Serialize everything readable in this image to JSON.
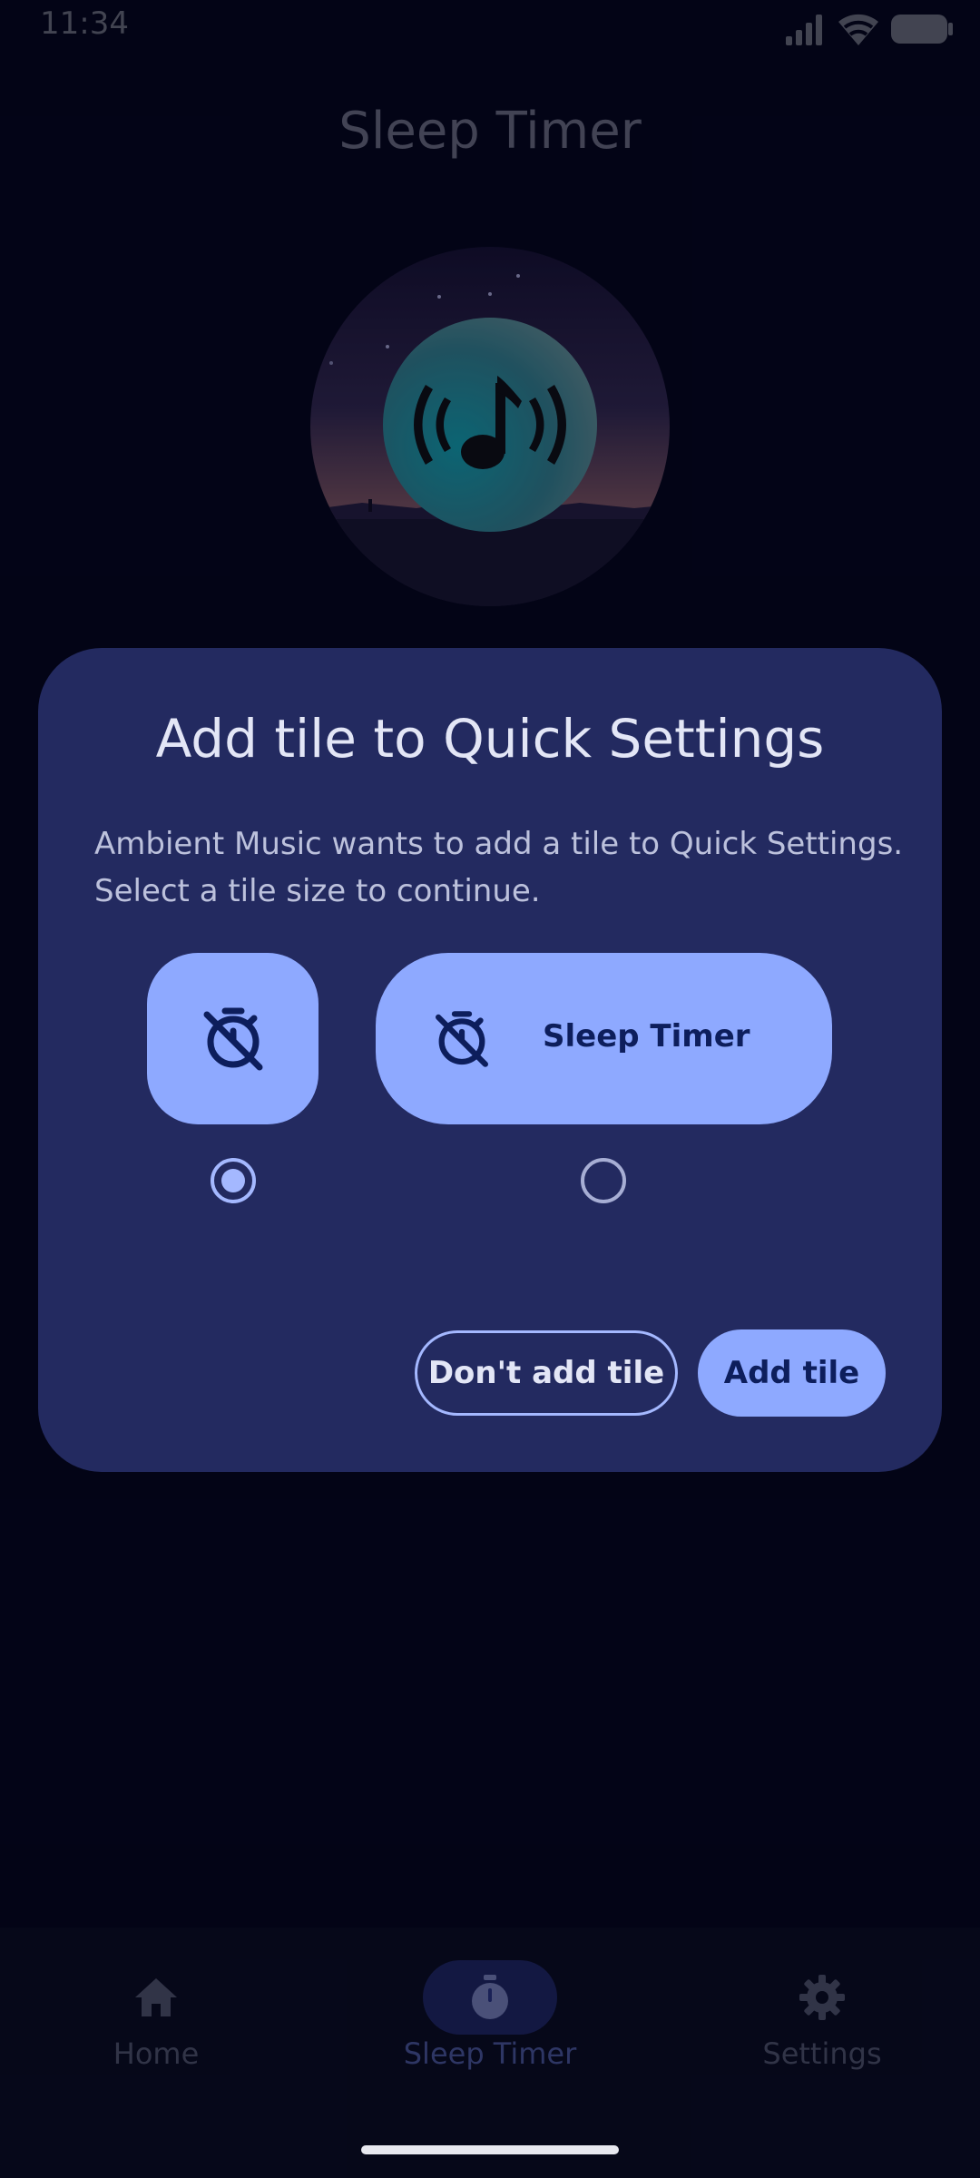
{
  "status_bar": {
    "time": "11:34",
    "icons": [
      "signal-icon",
      "wifi-icon",
      "battery-icon"
    ]
  },
  "page": {
    "title": "Sleep Timer",
    "hero_icon": "music-note-icon"
  },
  "dialog": {
    "title": "Add tile to Quick Settings",
    "message_line1": "Ambient Music wants to add a tile to Quick Settings.",
    "message_line2": "Select a tile size to continue.",
    "tiles": [
      {
        "size": "small",
        "icon": "timer-off-icon",
        "selected": true
      },
      {
        "size": "large",
        "icon": "timer-off-icon",
        "label": "Sleep Timer",
        "selected": false
      }
    ],
    "cancel_label": "Don't add tile",
    "confirm_label": "Add tile"
  },
  "bottom_nav": {
    "items": [
      {
        "label": "Home",
        "icon": "home-icon",
        "active": false
      },
      {
        "label": "Sleep Timer",
        "icon": "stopwatch-icon",
        "active": true
      },
      {
        "label": "Settings",
        "icon": "gear-icon",
        "active": false
      }
    ]
  },
  "colors": {
    "background": "#04051a",
    "dialog": "#232a60",
    "accent": "#8ea9ff",
    "on_accent": "#0d1e5c"
  }
}
